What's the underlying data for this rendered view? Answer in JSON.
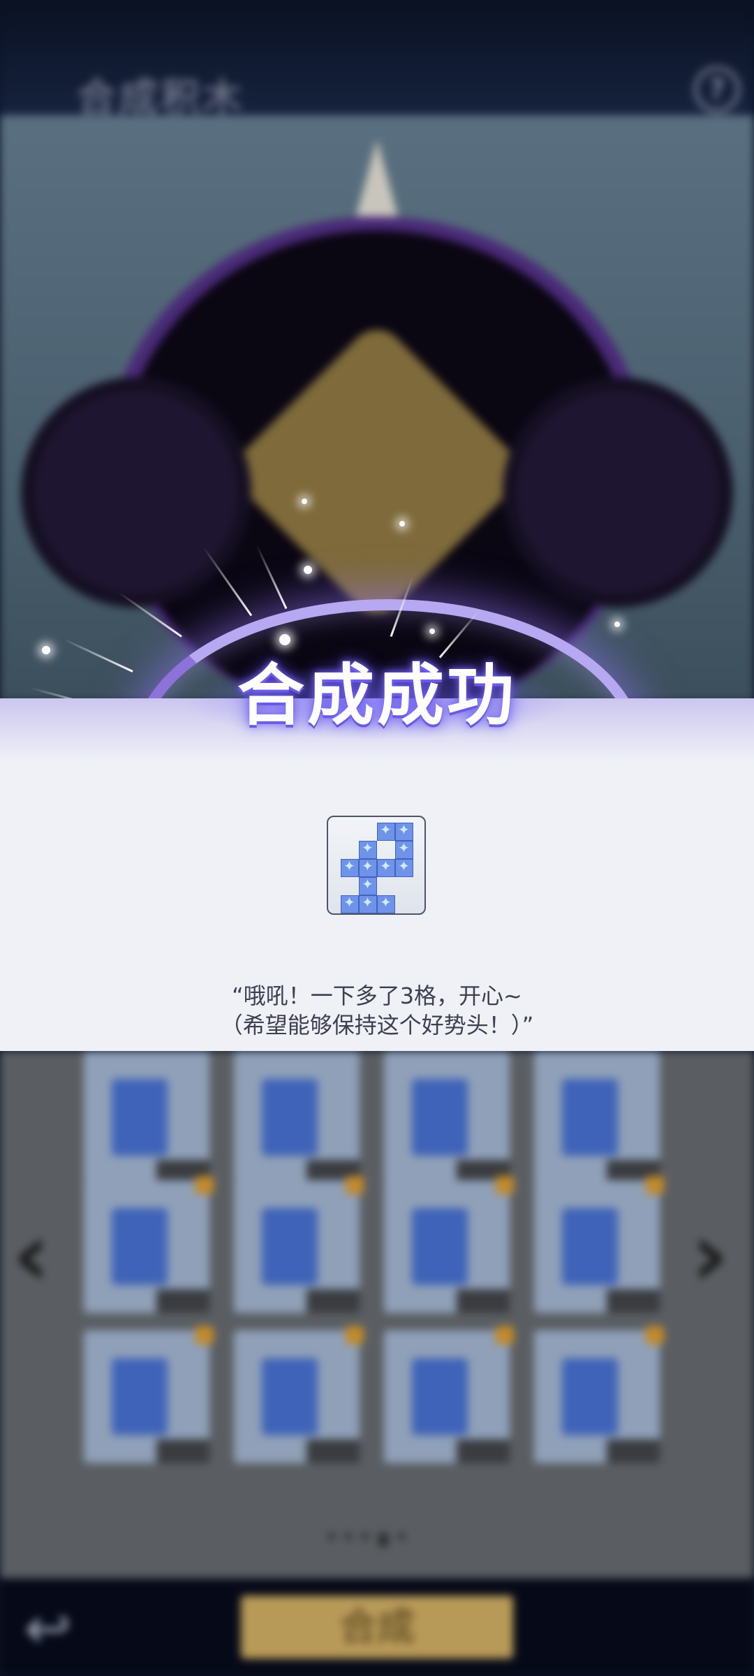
{
  "background_screen": {
    "title": "合成积木",
    "help_icon_label": "?",
    "confirm_button_label": "合成"
  },
  "result": {
    "title": "合成成功",
    "quote_line1": "“哦吼！一下多了3格，开心~",
    "quote_line2": "（希望能够保持这个好势头！）”"
  },
  "pager": {
    "pages": 5,
    "current": 4
  },
  "colors": {
    "panel": "#eff1f7",
    "glow": "#7b6bff",
    "block": "#6f93e8",
    "confirm": "#b89a58"
  }
}
